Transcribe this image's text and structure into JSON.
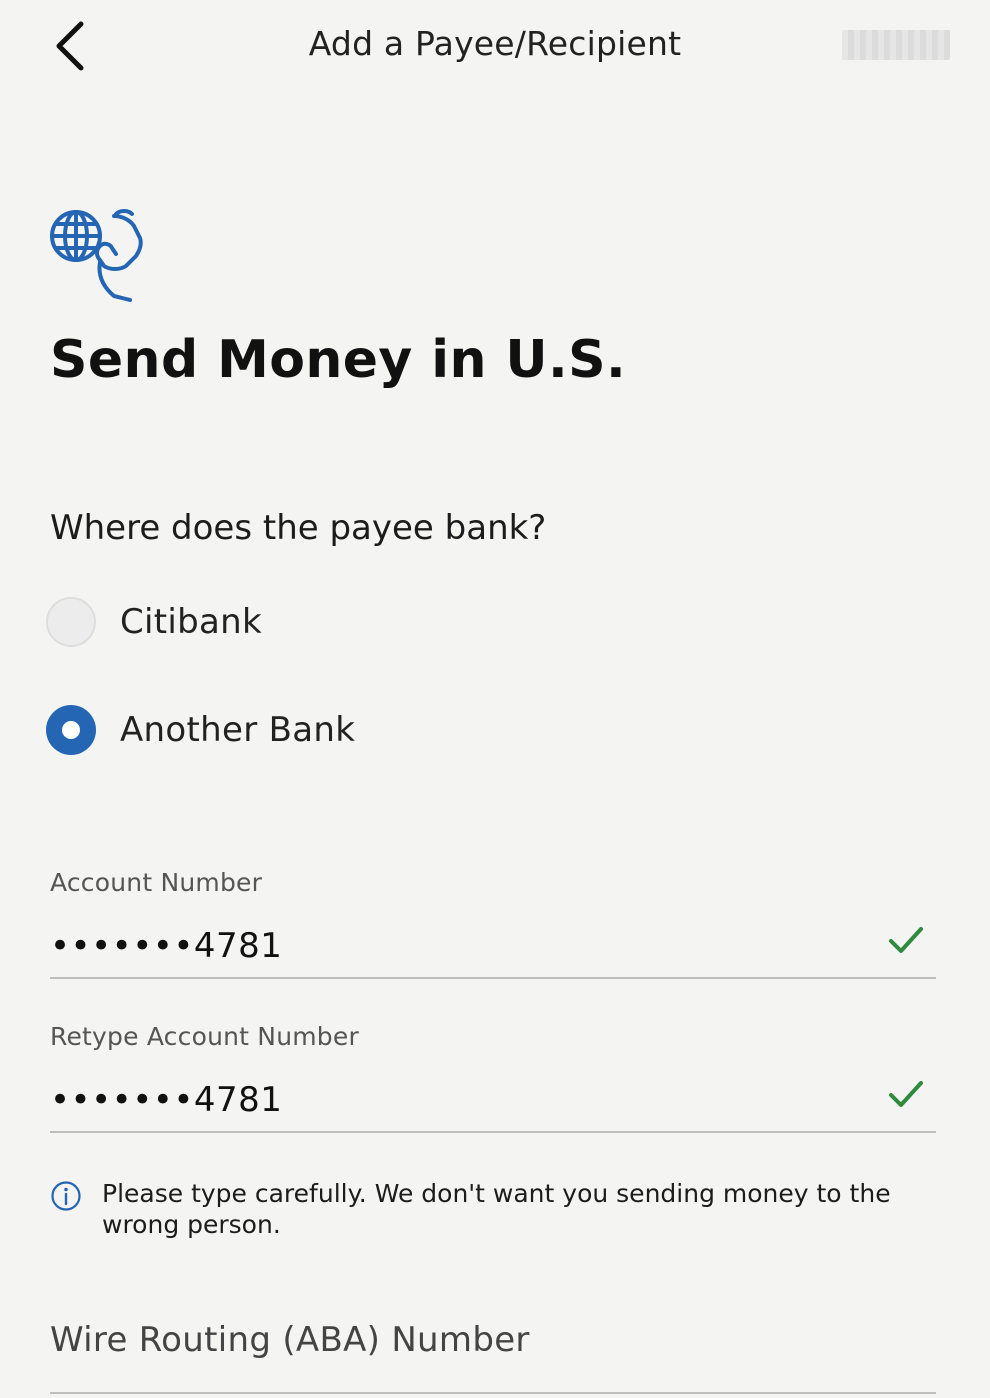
{
  "header": {
    "title": "Add a Payee/Recipient"
  },
  "hero": {
    "title": "Send Money in U.S."
  },
  "bank_question": {
    "label": "Where does the payee bank?",
    "options": [
      {
        "label": "Citibank",
        "selected": false
      },
      {
        "label": "Another Bank",
        "selected": true
      }
    ]
  },
  "account_number": {
    "label": "Account Number",
    "value": "•••••••4781",
    "valid": true
  },
  "retype_account_number": {
    "label": "Retype Account Number",
    "value": "•••••••4781",
    "valid": true
  },
  "info": {
    "text": "Please type carefully. We don't want you sending money to the wrong person."
  },
  "routing": {
    "placeholder": "Wire Routing (ABA) Number"
  },
  "colors": {
    "accent": "#2566b4",
    "check": "#2e8b3e",
    "background": "#f4f4f3"
  }
}
